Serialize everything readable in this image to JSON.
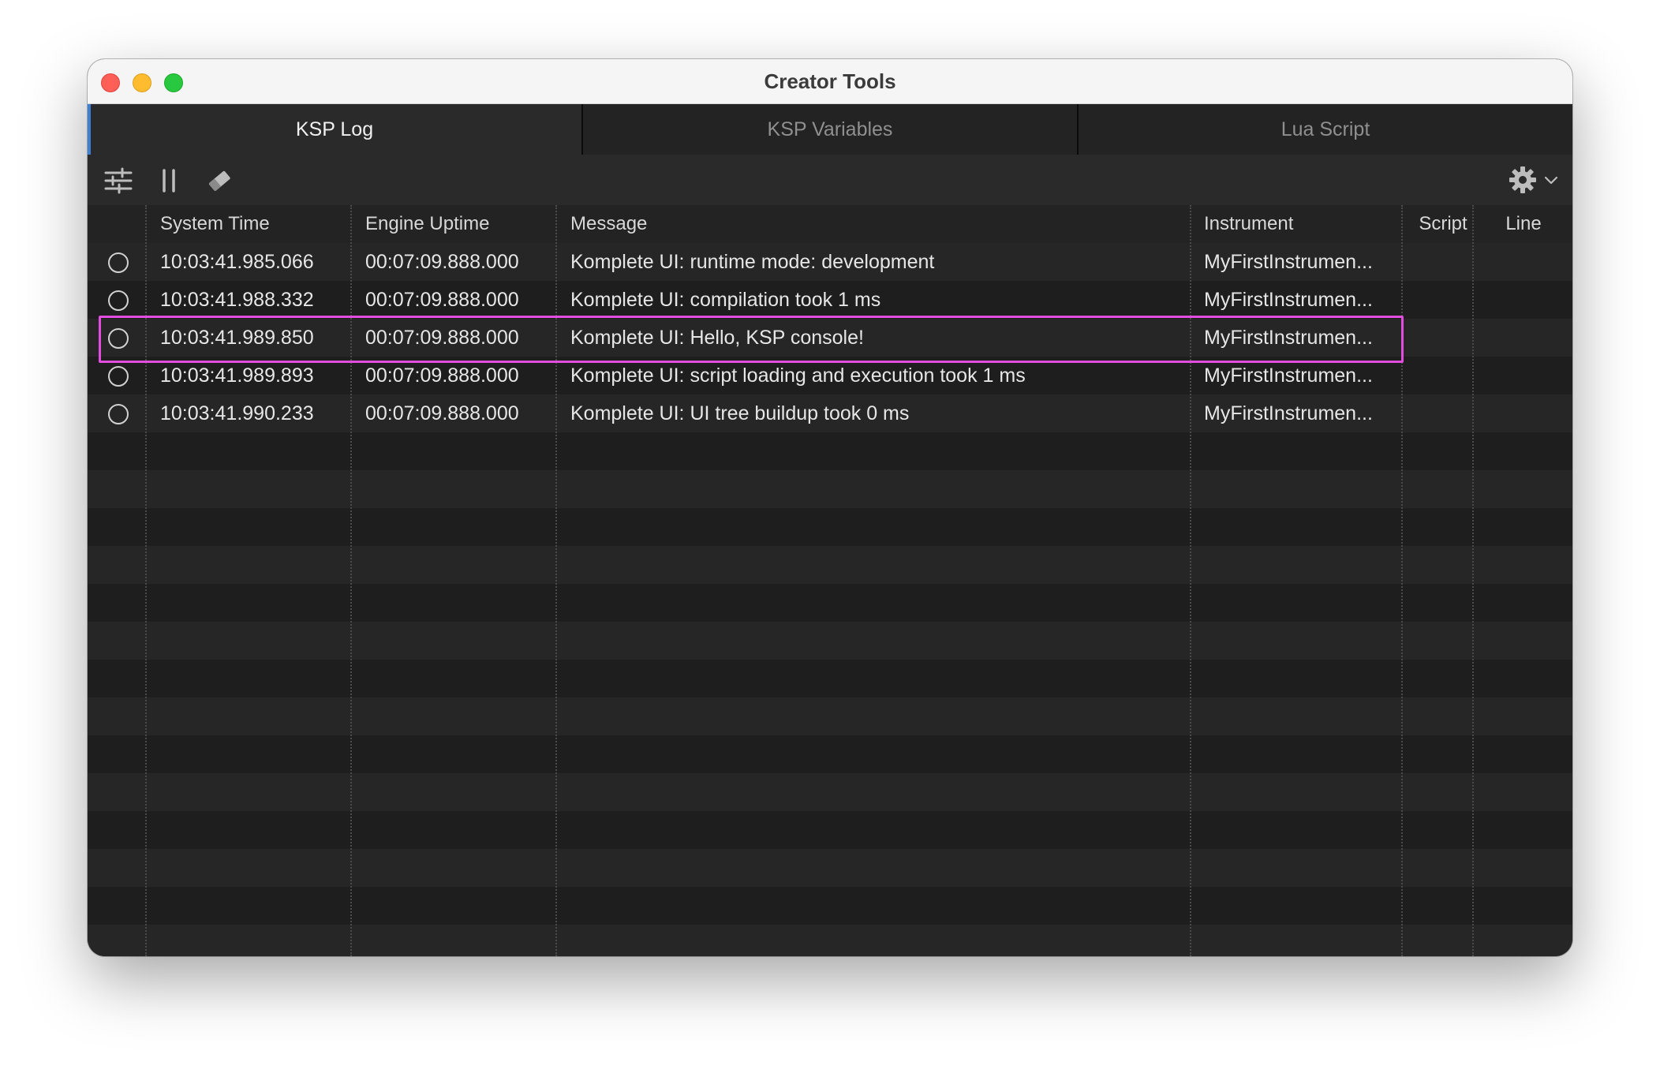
{
  "window": {
    "title": "Creator Tools"
  },
  "tabs": [
    {
      "label": "KSP Log",
      "active": true
    },
    {
      "label": "KSP Variables",
      "active": false
    },
    {
      "label": "Lua Script",
      "active": false
    }
  ],
  "toolbar": {
    "icons": [
      "sliders-icon",
      "pause-icon",
      "eraser-icon"
    ],
    "settings_icon": "gear-icon",
    "dropdown_icon": "chevron-down-icon"
  },
  "table": {
    "columns": [
      "System Time",
      "Engine Uptime",
      "Message",
      "Instrument",
      "Script",
      "Line"
    ],
    "rows": [
      {
        "system_time": "10:03:41.985.066",
        "engine_uptime": "00:07:09.888.000",
        "message": "Komplete UI: runtime mode: development",
        "instrument": "MyFirstInstrumen...",
        "script": "",
        "line": ""
      },
      {
        "system_time": "10:03:41.988.332",
        "engine_uptime": "00:07:09.888.000",
        "message": "Komplete UI: compilation took 1 ms",
        "instrument": "MyFirstInstrumen...",
        "script": "",
        "line": ""
      },
      {
        "system_time": "10:03:41.989.850",
        "engine_uptime": "00:07:09.888.000",
        "message": "Komplete UI: Hello, KSP console!",
        "instrument": "MyFirstInstrumen...",
        "script": "",
        "line": ""
      },
      {
        "system_time": "10:03:41.989.893",
        "engine_uptime": "00:07:09.888.000",
        "message": "Komplete UI: script loading and execution took 1 ms",
        "instrument": "MyFirstInstrumen...",
        "script": "",
        "line": ""
      },
      {
        "system_time": "10:03:41.990.233",
        "engine_uptime": "00:07:09.888.000",
        "message": "Komplete UI: UI tree buildup took 0 ms",
        "instrument": "MyFirstInstrumen...",
        "script": "",
        "line": ""
      }
    ],
    "highlighted_row": 2
  },
  "colors": {
    "highlight": "#e24de0",
    "active_tab_indicator": "#3d7fd6"
  }
}
